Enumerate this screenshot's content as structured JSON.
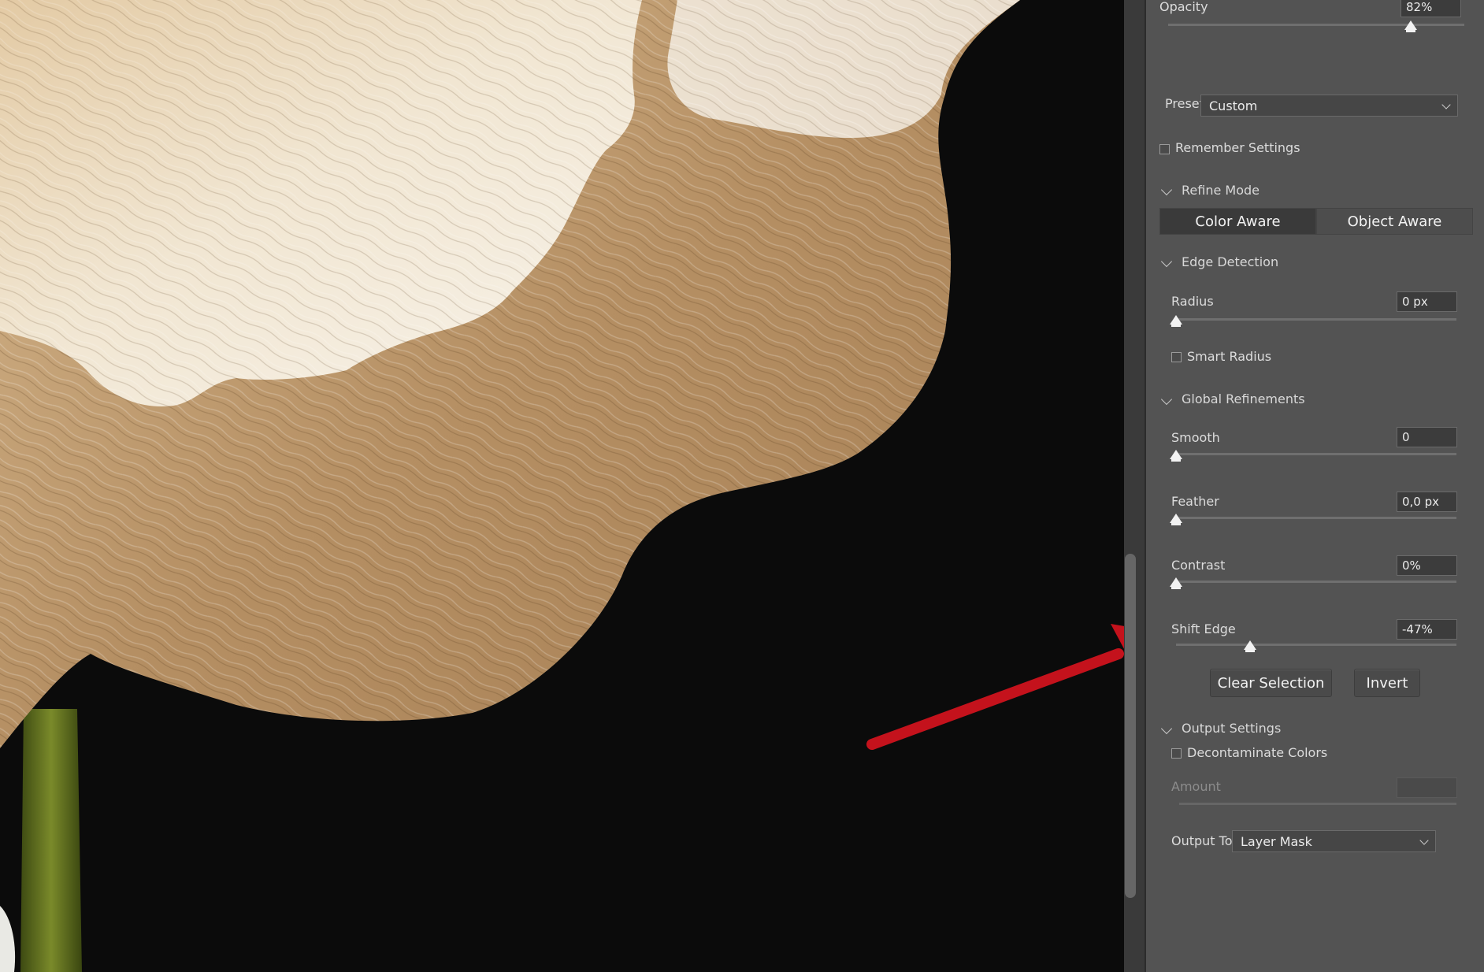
{
  "colors": {
    "panel_bg": "#535353",
    "canvas_bg": "#0b0b0b",
    "arrow": "#c4121c",
    "petal": "#c9a67a"
  },
  "opacity": {
    "label": "Opacity",
    "value": "82%",
    "level": 0.82
  },
  "preset": {
    "label": "Preset",
    "value": "Custom"
  },
  "remember_settings": {
    "label": "Remember Settings",
    "checked": false
  },
  "refine_mode": {
    "title": "Refine Mode",
    "options": [
      "Color Aware",
      "Object Aware"
    ],
    "selected": "Color Aware"
  },
  "edge_detection": {
    "title": "Edge Detection",
    "radius": {
      "label": "Radius",
      "value": "0 px",
      "level": 0
    },
    "smart_radius": {
      "label": "Smart Radius",
      "checked": false
    }
  },
  "global_refinements": {
    "title": "Global Refinements",
    "smooth": {
      "label": "Smooth",
      "value": "0",
      "level": 0
    },
    "feather": {
      "label": "Feather",
      "value": "0,0 px",
      "level": 0
    },
    "contrast": {
      "label": "Contrast",
      "value": "0%",
      "level": 0
    },
    "shift_edge": {
      "label": "Shift Edge",
      "value": "-47%",
      "level": -0.47
    },
    "clear_selection": "Clear Selection",
    "invert": "Invert"
  },
  "output_settings": {
    "title": "Output Settings",
    "decontaminate": {
      "label": "Decontaminate Colors",
      "checked": false
    },
    "amount": {
      "label": "Amount",
      "value": ""
    },
    "output_to": {
      "label": "Output To",
      "value": "Layer Mask"
    }
  }
}
